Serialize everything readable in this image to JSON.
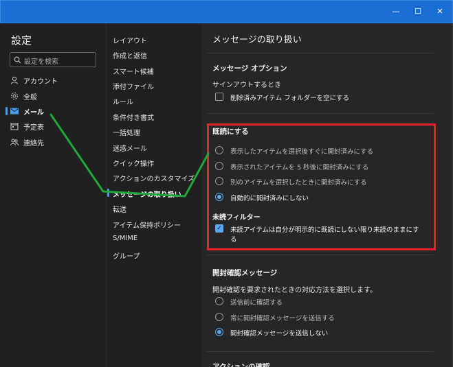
{
  "window": {
    "minimize_glyph": "—",
    "maximize_glyph": "☐",
    "close_glyph": "✕"
  },
  "sidebar": {
    "title": "設定",
    "search_placeholder": "設定を検索",
    "items": [
      {
        "label": "アカウント",
        "icon": "person-icon"
      },
      {
        "label": "全般",
        "icon": "gear-icon"
      },
      {
        "label": "メール",
        "icon": "mail-icon"
      },
      {
        "label": "予定表",
        "icon": "calendar-icon"
      },
      {
        "label": "連絡先",
        "icon": "people-icon"
      }
    ],
    "active_index": 2
  },
  "subnav": {
    "items": [
      "レイアウト",
      "作成と返信",
      "スマート候補",
      "添付ファイル",
      "ルール",
      "条件付き書式",
      "一括処理",
      "迷惑メール",
      "クイック操作",
      "アクションのカスタマイズ",
      "メッセージの取り扱い",
      "転送",
      "アイテム保持ポリシー",
      "S/MIME",
      "グループ"
    ],
    "active_index": 10
  },
  "main": {
    "title": "メッセージの取り扱い",
    "message_options": {
      "heading": "メッセージ オプション",
      "signout_label": "サインアウトするとき",
      "empty_deleted_label": "削除済みアイテム フォルダーを空にする",
      "empty_deleted_checked": false
    },
    "mark_as_read": {
      "heading": "既読にする",
      "options": [
        "表示したアイテムを選択後すぐに開封済みにする",
        "表示されたアイテムを 5 秒後に開封済みにする",
        "別のアイテムを選択したときに開封済みにする",
        "自動的に開封済みにしない"
      ],
      "selected_index": 3,
      "unread_filter_heading": "未読フィルター",
      "unread_filter_label_line1": "未読アイテムは自分が明示的に既読にしない限り未読のままにす",
      "unread_filter_label_line2": "る",
      "unread_filter_checked": true
    },
    "read_receipts": {
      "heading": "開封確認メッセージ",
      "question": "開封確認を要求されたときの対応方法を選択します。",
      "options": [
        "送信前に確認する",
        "常に開封確認メッセージを送信する",
        "開封確認メッセージを送信しない"
      ],
      "selected_index": 2
    },
    "next_heading": "アクションの確認"
  },
  "colors": {
    "titlebar": "#1b6fd4",
    "accent": "#5aa7f5",
    "highlight_box": "#e8212b",
    "annotation_line": "#1fa83a"
  }
}
